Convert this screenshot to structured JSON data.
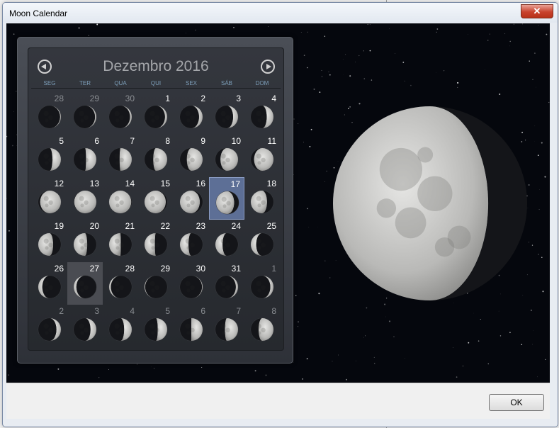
{
  "window": {
    "title": "Moon Calendar",
    "close_glyph": "✕"
  },
  "calendar": {
    "month_title": "Dezembro 2016",
    "weekdays": [
      "SEG",
      "TER",
      "QUA",
      "QUI",
      "SEX",
      "SÁB",
      "DOM"
    ],
    "today_day": 17,
    "selected_day": 27,
    "days": [
      {
        "d": "28",
        "m": true,
        "p": 0.02
      },
      {
        "d": "29",
        "m": true,
        "p": 0.03
      },
      {
        "d": "30",
        "m": true,
        "p": 0.04
      },
      {
        "d": "1",
        "m": false,
        "p": 0.05
      },
      {
        "d": "2",
        "m": false,
        "p": 0.08
      },
      {
        "d": "3",
        "m": false,
        "p": 0.11
      },
      {
        "d": "4",
        "m": false,
        "p": 0.15
      },
      {
        "d": "5",
        "m": false,
        "p": 0.19
      },
      {
        "d": "6",
        "m": false,
        "p": 0.23
      },
      {
        "d": "7",
        "m": false,
        "p": 0.27
      },
      {
        "d": "8",
        "m": false,
        "p": 0.31
      },
      {
        "d": "9",
        "m": false,
        "p": 0.35
      },
      {
        "d": "10",
        "m": false,
        "p": 0.39
      },
      {
        "d": "11",
        "m": false,
        "p": 0.43
      },
      {
        "d": "12",
        "m": false,
        "p": 0.46
      },
      {
        "d": "13",
        "m": false,
        "p": 0.49
      },
      {
        "d": "14",
        "m": false,
        "p": 0.51
      },
      {
        "d": "15",
        "m": false,
        "p": 0.53
      },
      {
        "d": "16",
        "m": false,
        "p": 0.56
      },
      {
        "d": "17",
        "m": false,
        "p": 0.6
      },
      {
        "d": "18",
        "m": false,
        "p": 0.64
      },
      {
        "d": "19",
        "m": false,
        "p": 0.67
      },
      {
        "d": "20",
        "m": false,
        "p": 0.7
      },
      {
        "d": "21",
        "m": false,
        "p": 0.74
      },
      {
        "d": "22",
        "m": false,
        "p": 0.77
      },
      {
        "d": "23",
        "m": false,
        "p": 0.81
      },
      {
        "d": "24",
        "m": false,
        "p": 0.84
      },
      {
        "d": "25",
        "m": false,
        "p": 0.88
      },
      {
        "d": "26",
        "m": false,
        "p": 0.91
      },
      {
        "d": "27",
        "m": false,
        "p": 0.94
      },
      {
        "d": "28",
        "m": false,
        "p": 0.96
      },
      {
        "d": "29",
        "m": false,
        "p": 0.985
      },
      {
        "d": "30",
        "m": false,
        "p": 0.015
      },
      {
        "d": "31",
        "m": false,
        "p": 0.05
      },
      {
        "d": "1",
        "m": true,
        "p": 0.07
      },
      {
        "d": "2",
        "m": true,
        "p": 0.1
      },
      {
        "d": "3",
        "m": true,
        "p": 0.13
      },
      {
        "d": "4",
        "m": true,
        "p": 0.17
      },
      {
        "d": "5",
        "m": true,
        "p": 0.21
      },
      {
        "d": "6",
        "m": true,
        "p": 0.25
      },
      {
        "d": "7",
        "m": true,
        "p": 0.29
      },
      {
        "d": "8",
        "m": true,
        "p": 0.33
      }
    ],
    "moon_colors": {
      "lit": "#d6d6d4",
      "shadow": "#151619"
    }
  },
  "big_moon": {
    "phase": 0.6
  },
  "buttons": {
    "ok_label": "OK"
  }
}
